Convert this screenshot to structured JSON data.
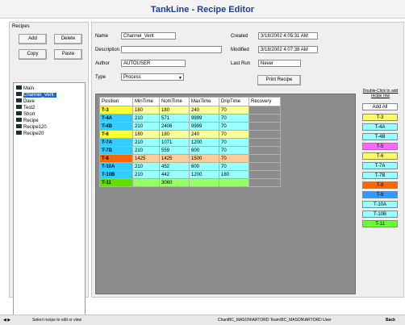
{
  "title": "TankLine - Recipe Editor",
  "recipes_panel": {
    "label": "Recipes",
    "add": "Add",
    "delete": "Delete",
    "copy": "Copy",
    "paste": "Paste",
    "items": [
      "Main",
      "Channel_Vent",
      "Dave",
      "Test2",
      "Short",
      "Recipe",
      "Recipe120",
      "Recipe20"
    ]
  },
  "form": {
    "name_label": "Name",
    "name_value": "Channel_Vent",
    "description_label": "Description",
    "description_value": "",
    "author_label": "Author",
    "author_value": "AUTOUSER",
    "type_label": "Type",
    "type_value": "Process",
    "created_label": "Created",
    "created_value": "3/18/2002 4:05:31 AM",
    "modified_label": "Modified",
    "modified_value": "3/18/2002 4:07:38 AM",
    "lastrun_label": "Last Run",
    "lastrun_value": "Never",
    "print_button": "Print Recipe"
  },
  "table": {
    "headers": [
      "Position",
      "MinTime",
      "NomTime",
      "MaxTime",
      "DripTime",
      "Recovery"
    ],
    "rows": [
      [
        "T-3",
        "180",
        "180",
        "240",
        "70",
        ""
      ],
      [
        "T-4A",
        "210",
        "571",
        "9999",
        "70",
        ""
      ],
      [
        "T-4B",
        "210",
        "2406",
        "9999",
        "70",
        ""
      ],
      [
        "T-6",
        "180",
        "180",
        "240",
        "70",
        ""
      ],
      [
        "T-7A",
        "210",
        "1071",
        "1200",
        "70",
        ""
      ],
      [
        "T-7B",
        "210",
        "559",
        "600",
        "70",
        ""
      ],
      [
        "T-8",
        "1425",
        "1425",
        "1500",
        "70",
        ""
      ],
      [
        "T-10A",
        "210",
        "452",
        "600",
        "70",
        ""
      ],
      [
        "T-10B",
        "210",
        "442",
        "1200",
        "180",
        ""
      ],
      [
        "T-11",
        "",
        "3060",
        "",
        "",
        ""
      ]
    ],
    "row_colors": [
      "#ffff99",
      "#99ffff",
      "#99ffff",
      "#ffff99",
      "#99ffff",
      "#99ffff",
      "#ffcc99",
      "#99ffff",
      "#99ffff",
      "#99ff66"
    ],
    "pos_colors": [
      "#ffff33",
      "#33ccff",
      "#33ccff",
      "#ffff33",
      "#33ccff",
      "#33ccff",
      "#ff6600",
      "#33ccff",
      "#33ccff",
      "#66dd00"
    ]
  },
  "sidebar": {
    "hint": "Double-Click to add recipe row",
    "add_all": "Add All",
    "tanks": [
      {
        "label": "T-3",
        "color": "#ffff66"
      },
      {
        "label": "T-4A",
        "color": "#99ffff"
      },
      {
        "label": "T-4B",
        "color": "#99ffff"
      },
      {
        "label": "T-5",
        "color": "#ff66ff"
      },
      {
        "label": "T-6",
        "color": "#ffff66"
      },
      {
        "label": "T-7A",
        "color": "#99ffff"
      },
      {
        "label": "T-7B",
        "color": "#99ffff"
      },
      {
        "label": "T-8",
        "color": "#ff6600"
      },
      {
        "label": "T-9",
        "color": "#3399ff"
      },
      {
        "label": "T-10A",
        "color": "#99ffff"
      },
      {
        "label": "T-10B",
        "color": "#99ffff"
      },
      {
        "label": "T-11",
        "color": "#66ff33"
      }
    ]
  },
  "status": {
    "left": "Select recipe to edit or view",
    "right": "ChanlBC_MASON\\ARTORD  Team\\BC_MASON\\ARTORD  User",
    "back": "Back"
  }
}
